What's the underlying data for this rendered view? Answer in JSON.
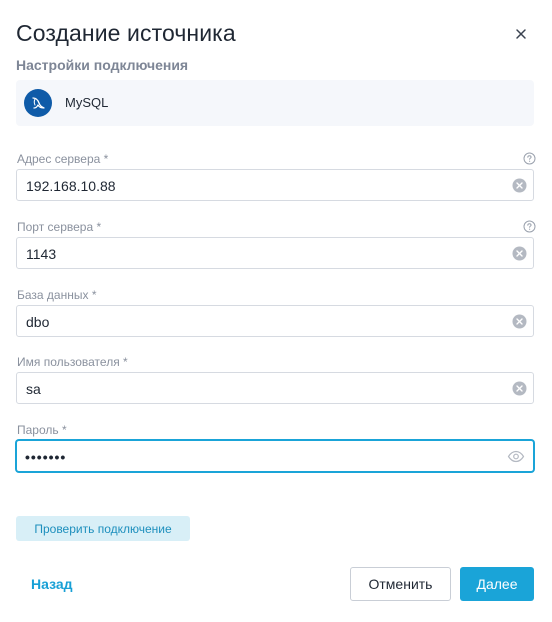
{
  "dialog": {
    "title": "Создание источника",
    "subtitle": "Настройки подключения",
    "close_icon": "close-icon"
  },
  "source": {
    "name": "MySQL",
    "icon": "mysql-dolphin-icon",
    "icon_color": "#0f5ba8"
  },
  "fields": {
    "server_address": {
      "label": "Адрес сервера *",
      "value": "192.168.10.88",
      "help_icon": "question-circle-icon",
      "action_icon": "clear-icon"
    },
    "server_port": {
      "label": "Порт сервера *",
      "value": "1143",
      "help_icon": "question-circle-icon",
      "action_icon": "clear-icon"
    },
    "database": {
      "label": "База данных *",
      "value": "dbo",
      "action_icon": "clear-icon"
    },
    "username": {
      "label": "Имя пользователя *",
      "value": "sa",
      "action_icon": "clear-icon"
    },
    "password": {
      "label": "Пароль *",
      "masked_value": "•••••••",
      "action_icon": "eye-icon",
      "focused": true
    }
  },
  "actions": {
    "check_connection_label": "Проверить подключение",
    "back_label": "Назад",
    "cancel_label": "Отменить",
    "next_label": "Далее"
  },
  "colors": {
    "accent": "#1aa4d8",
    "secondary_button_bg": "#d8eff7",
    "label_text": "#8a919e",
    "card_bg": "#f5f7fb"
  }
}
